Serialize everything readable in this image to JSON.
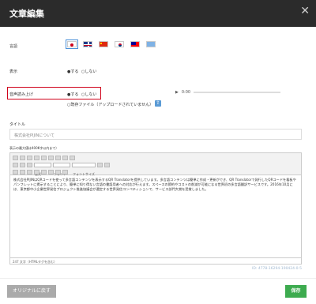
{
  "header": {
    "title": "文章編集",
    "close": "✕"
  },
  "language": {
    "label": "言語"
  },
  "display": {
    "label": "表示",
    "opt_on": "●する",
    "opt_off": "○しない"
  },
  "tts": {
    "label": "音声読み上げ",
    "opt_on": "●する",
    "opt_off": "○しない",
    "file_opt": "○既存ファイル（アップロードされていません）",
    "time": "0:00"
  },
  "title_section": {
    "label": "タイトル",
    "value": "株式会社PIJINについて"
  },
  "body_section": {
    "label": "表示の最大値は400K字以内まで）",
    "toolbar_fonts": [
      "書式",
      "フォント",
      "フォントサイズ"
    ],
    "content": "株式会社PIJINはQRコードを使って多言語コンテンツを表示するQR Translatorを提供しています。多言語コンテンツは簡単に作成・更新ができ、QR Translatorで発行したQRコードを看板やパンフレットに掲示することにより、簡単に知り得ない言語の書語用者への対応が行えます。スペースの節約やコストの削減が可能になる世界初の多言語翻訳サービスです。2016年10月には、東京都中小企業世界発信プロジェクト推進協議会が選定する世界発信コンペティションで、サービス部門大賞を受賞しました。",
    "status": "247 文字（HTMLタグを含む）"
  },
  "doc_id": "ID: 4778-16294-190424-0-5",
  "buttons": {
    "reset": "オリジナルに戻す",
    "save": "保存"
  }
}
